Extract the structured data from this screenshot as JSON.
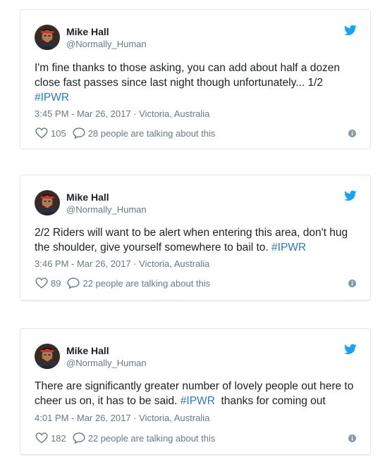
{
  "colors": {
    "text": "#1c2022",
    "muted": "#697882",
    "link": "#2b7bb9",
    "twitter_blue": "#1da1f2",
    "border": "#e1e8ed"
  },
  "icons": {
    "brand": "twitter-bird-icon",
    "like": "heart-icon",
    "reply": "speech-bubble-icon",
    "info": "info-icon"
  },
  "tweets": [
    {
      "author": {
        "name": "Mike Hall",
        "handle": "@Normally_Human"
      },
      "text_before": "I'm fine thanks to those asking, you can add about half a dozen close fast passes since last night though unfortunately... 1/2\n",
      "hashtag": "#IPWR",
      "text_after": "",
      "timestamp": "3:45 PM - Mar 26, 2017",
      "separator": " · ",
      "location": "Victoria, Australia",
      "likes": "105",
      "talking": "28 people are talking about this"
    },
    {
      "author": {
        "name": "Mike Hall",
        "handle": "@Normally_Human"
      },
      "text_before": "2/2 Riders will want to be alert when entering this area, don't hug the shoulder, give yourself somewhere to bail to. ",
      "hashtag": "#IPWR",
      "text_after": "",
      "timestamp": "3:46 PM - Mar 26, 2017",
      "separator": " · ",
      "location": "Victoria, Australia",
      "likes": "89",
      "talking": "22 people are talking about this"
    },
    {
      "author": {
        "name": "Mike Hall",
        "handle": "@Normally_Human"
      },
      "text_before": "There are significantly greater number of lovely people out here to cheer us on, it has to be said. ",
      "hashtag": "#IPWR",
      "text_after": "  thanks for coming out",
      "timestamp": "4:01 PM - Mar 26, 2017",
      "separator": " · ",
      "location": "Victoria, Australia",
      "likes": "182",
      "talking": "22 people are talking about this"
    }
  ]
}
